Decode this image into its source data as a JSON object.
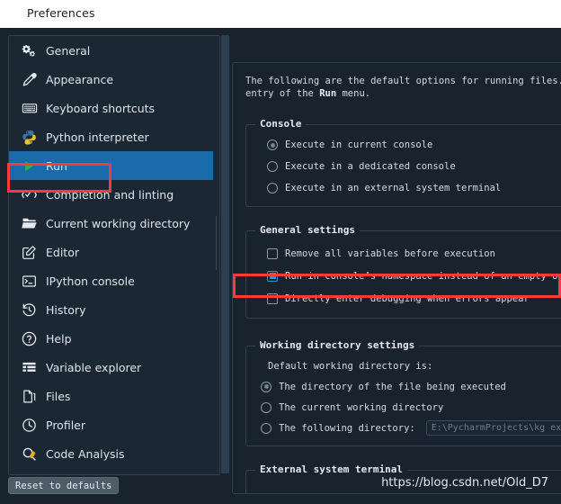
{
  "window": {
    "title": "Preferences"
  },
  "sidebar": {
    "items": [
      {
        "label": "General",
        "icon": "gears-icon",
        "selected": false
      },
      {
        "label": "Appearance",
        "icon": "eyedropper-icon",
        "selected": false
      },
      {
        "label": "Keyboard shortcuts",
        "icon": "keyboard-icon",
        "selected": false
      },
      {
        "label": "Python interpreter",
        "icon": "python-icon",
        "selected": false
      },
      {
        "label": "Run",
        "icon": "play-triangle-icon",
        "selected": true
      },
      {
        "label": "Completion and linting",
        "icon": "checkmark-code-icon",
        "selected": false
      },
      {
        "label": "Current working directory",
        "icon": "open-folder-icon",
        "selected": false
      },
      {
        "label": "Editor",
        "icon": "pencil-square-icon",
        "selected": false
      },
      {
        "label": "IPython console",
        "icon": "terminal-icon",
        "selected": false
      },
      {
        "label": "History",
        "icon": "clock-rewind-icon",
        "selected": false
      },
      {
        "label": "Help",
        "icon": "question-circle-icon",
        "selected": false
      },
      {
        "label": "Variable explorer",
        "icon": "table-list-icon",
        "selected": false
      },
      {
        "label": "Files",
        "icon": "files-icon",
        "selected": false
      },
      {
        "label": "Profiler",
        "icon": "clock-icon",
        "selected": false
      },
      {
        "label": "Code Analysis",
        "icon": "magnifier-check-icon",
        "selected": false
      }
    ]
  },
  "content": {
    "intro_line1": "The following are the default options for running files. The",
    "intro_line2_pre": "entry of the ",
    "intro_line2_bold": "Run",
    "intro_line2_post": " menu.",
    "console_group": {
      "title": "Console",
      "options": [
        {
          "label": "Execute in current console",
          "checked": true
        },
        {
          "label": "Execute in a dedicated console",
          "checked": false
        },
        {
          "label": "Execute in an external system terminal",
          "checked": false
        }
      ]
    },
    "general_group": {
      "title": "General settings",
      "options": [
        {
          "label": "Remove all variables before execution",
          "checked": false
        },
        {
          "label": "Run in console’s namespace instead of an empty one",
          "checked": true
        },
        {
          "label": "Directly enter debugging when errors appear",
          "checked": false
        }
      ]
    },
    "workdir_group": {
      "title": "Working directory settings",
      "caption": "Default working directory is:",
      "options": [
        {
          "label": "The directory of the file being executed",
          "checked": true
        },
        {
          "label": "The current working directory",
          "checked": false
        },
        {
          "label": "The following directory:",
          "checked": false
        }
      ],
      "path_value": "E:\\PycharmProjects\\kg exp"
    },
    "external_group": {
      "title": "External system terminal"
    }
  },
  "footer": {
    "reset_label": "Reset to defaults",
    "watermark": "https://blog.csdn.net/Old_D7"
  },
  "colors": {
    "dialog_bg": "#19232d",
    "panel_bg": "#1b2733",
    "selection_blue": "#1a6bab",
    "checkbox_blue": "#1f9ae8",
    "annotation_red": "#fb3b3b",
    "border": "#32414f",
    "text": "#d4dae1"
  }
}
